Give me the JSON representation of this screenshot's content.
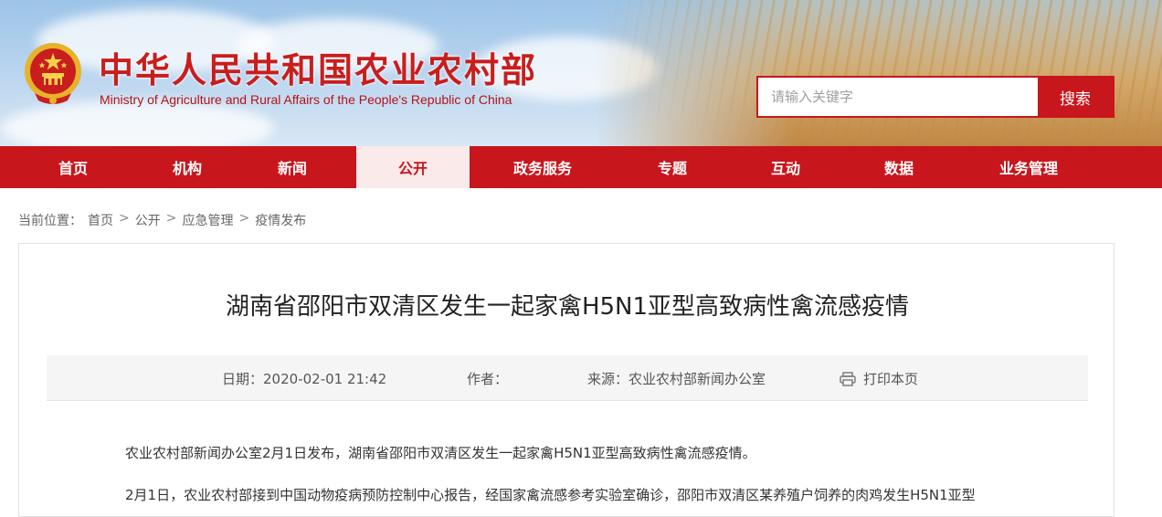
{
  "header": {
    "title": "中华人民共和国农业农村部",
    "subtitle": "Ministry of Agriculture and Rural Affairs of the People's Republic of China",
    "emblem_icon": "national-emblem-icon"
  },
  "search": {
    "placeholder": "请输入关键字",
    "button_label": "搜索"
  },
  "nav": {
    "items": [
      {
        "label": "首页"
      },
      {
        "label": "机构"
      },
      {
        "label": "新闻"
      },
      {
        "label": "公开"
      },
      {
        "label": "政务服务"
      },
      {
        "label": "专题"
      },
      {
        "label": "互动"
      },
      {
        "label": "数据"
      },
      {
        "label": "业务管理"
      }
    ],
    "active_index": 3
  },
  "breadcrumb": {
    "prefix": "当前位置：",
    "items": [
      "首页",
      "公开",
      "应急管理",
      "疫情发布"
    ],
    "separator": ">"
  },
  "article": {
    "title": "湖南省邵阳市双清区发生一起家禽H5N1亚型高致病性禽流感疫情",
    "meta": {
      "date_label": "日期：",
      "date_value": "2020-02-01 21:42",
      "author_label": "作者：",
      "author_value": "",
      "source_label": "来源：",
      "source_value": "农业农村部新闻办公室",
      "print_label": "打印本页",
      "print_icon": "printer-icon"
    },
    "paragraphs": [
      "农业农村部新闻办公室2月1日发布，湖南省邵阳市双清区发生一起家禽H5N1亚型高致病性禽流感疫情。",
      "2月1日，农业农村部接到中国动物疫病预防控制中心报告，经国家禽流感参考实验室确诊，邵阳市双清区某养殖户饲养的肉鸡发生H5N1亚型"
    ]
  },
  "colors": {
    "brand_red": "#c8161d",
    "nav_active_bg": "#fbeaea",
    "meta_bg": "#f5f5f5"
  }
}
